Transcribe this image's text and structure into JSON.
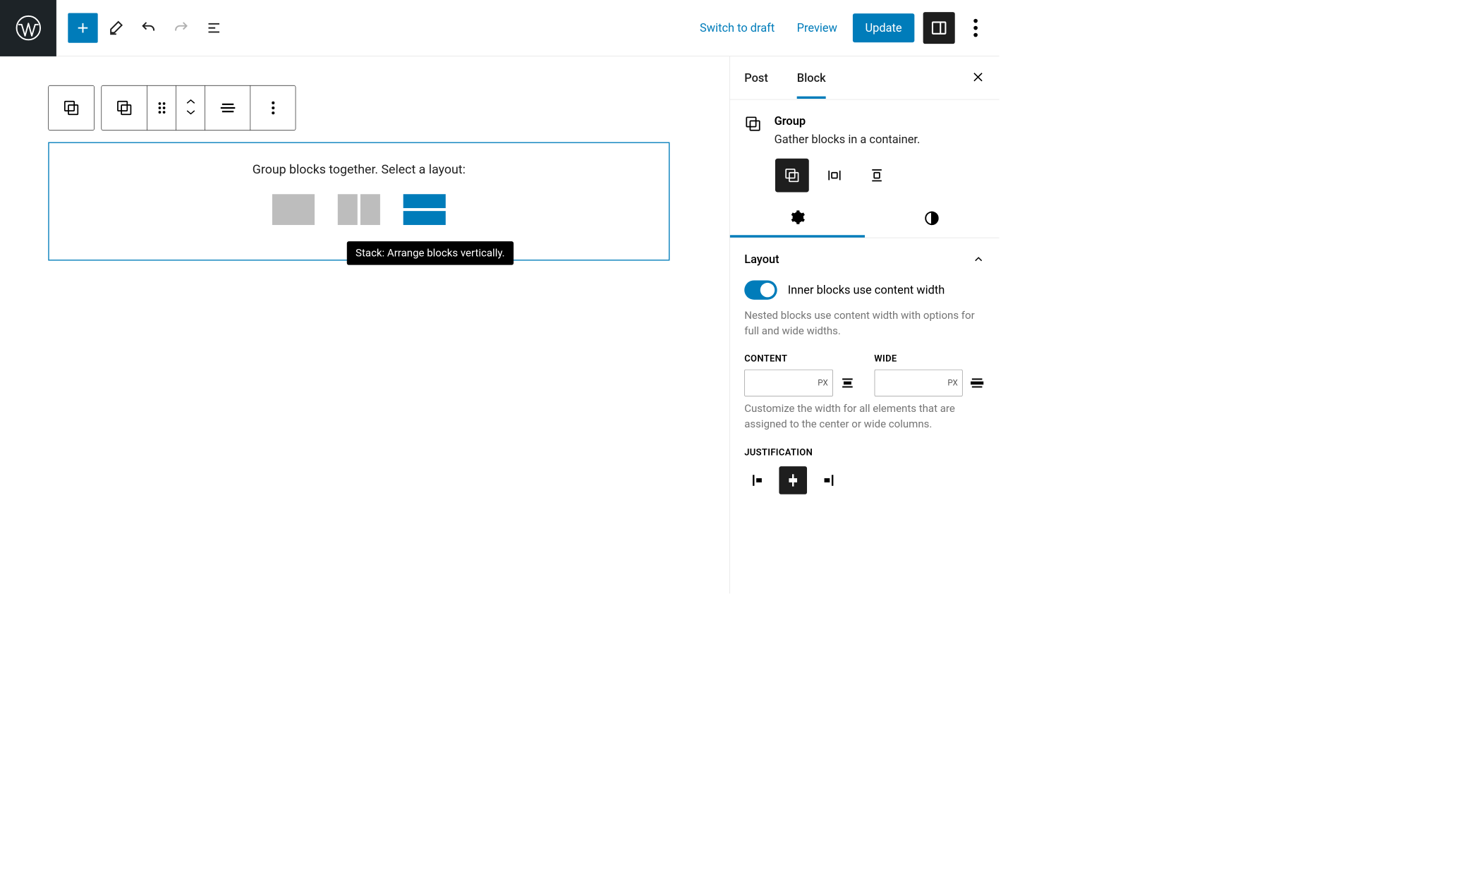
{
  "header": {
    "switch_draft": "Switch to draft",
    "preview": "Preview",
    "update": "Update"
  },
  "sidebar_tabs": {
    "post": "Post",
    "block": "Block"
  },
  "block": {
    "title": "Group",
    "description": "Gather blocks in a container."
  },
  "canvas": {
    "group_heading": "Group blocks together. Select a layout:",
    "tooltip": "Stack: Arrange blocks vertically."
  },
  "layout": {
    "heading": "Layout",
    "toggle_label": "Inner blocks use content width",
    "toggle_help": "Nested blocks use content width with options for full and wide widths.",
    "content_label": "CONTENT",
    "wide_label": "WIDE",
    "unit": "PX",
    "width_help": "Customize the width for all elements that are assigned to the center or wide columns.",
    "justification_label": "JUSTIFICATION",
    "content_value": "",
    "wide_value": ""
  }
}
